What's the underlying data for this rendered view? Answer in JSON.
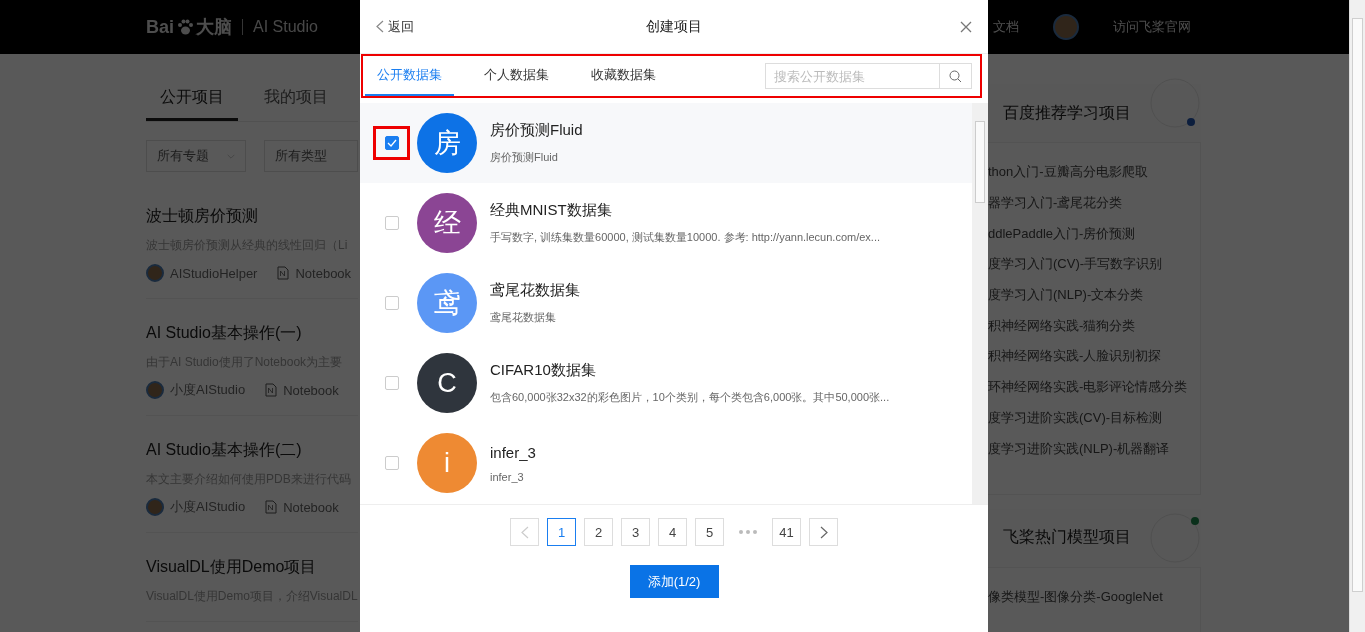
{
  "top_bar": {
    "logo": {
      "mark": "Bai",
      "brand": "大脑",
      "product": "AI Studio"
    },
    "doc_link": "文档",
    "official_link": "访问飞桨官网"
  },
  "project_tabs": [
    {
      "label": "公开项目",
      "selected": true
    },
    {
      "label": "我的项目",
      "selected": false
    }
  ],
  "filters": [
    {
      "value": "所有专题"
    },
    {
      "value": "所有类型"
    }
  ],
  "projects": [
    {
      "title": "波士顿房价预测",
      "description": "波士顿房价预测从经典的线性回归（Li",
      "author": "AIStudioHelper",
      "type": "Notebook"
    },
    {
      "title": "AI Studio基本操作(一)",
      "description": "由于AI Studio使用了Notebook为主要",
      "author": "小度AIStudio",
      "type": "Notebook"
    },
    {
      "title": "AI Studio基本操作(二)",
      "description": "本文主要介绍如何使用PDB来进行代码",
      "author": "小度AIStudio",
      "type": "Notebook"
    },
    {
      "title": "VisualDL使用Demo项目",
      "description": "VisualDL使用Demo项目，介绍VisualDL"
    }
  ],
  "side_cards": [
    {
      "title": "百度推荐学习项目",
      "items": [
        "thon入门-豆瓣高分电影爬取",
        "器学习入门-鸢尾花分类",
        "ddlePaddle入门-房价预测",
        "度学习入门(CV)-手写数字识别",
        "度学习入门(NLP)-文本分类",
        "积神经网络实践-猫狗分类",
        "积神经网络实践-人脸识别初探",
        "环神经网络实践-电影评论情感分类",
        "度学习进阶实践(CV)-目标检测",
        "度学习进阶实践(NLP)-机器翻译"
      ]
    },
    {
      "title": "飞桨热门模型项目",
      "items": [
        "像类模型-图像分类-GoogleNet"
      ]
    }
  ],
  "dialog": {
    "back": "返回",
    "title": "创建项目",
    "tabs_highlighted": true,
    "tabs": [
      {
        "label": "公开数据集",
        "selected": true
      },
      {
        "label": "个人数据集",
        "selected": false
      },
      {
        "label": "收藏数据集",
        "selected": false
      }
    ],
    "search": {
      "placeholder": "搜索公开数据集"
    },
    "datasets": [
      {
        "initial": "房",
        "color": "#0d72e6",
        "title": "房价预测Fluid",
        "description": "房价预测Fluid",
        "checked": true,
        "highlighted": true
      },
      {
        "initial": "经",
        "color": "#8b4594",
        "title": "经典MNIST数据集",
        "description": "手写数字, 训练集数量60000, 测试集数量10000. 参考: http://yann.lecun.com/ex...",
        "checked": false,
        "highlighted": false
      },
      {
        "initial": "鸢",
        "color": "#5b97f5",
        "title": "鸢尾花数据集",
        "description": "鸢尾花数据集",
        "checked": false,
        "highlighted": false
      },
      {
        "initial": "C",
        "color": "#2f353d",
        "title": "CIFAR10数据集",
        "description": "包含60,000张32x32的彩色图片，10个类别，每个类包含6,000张。其中50,000张...",
        "checked": false,
        "highlighted": false
      },
      {
        "initial": "i",
        "color": "#ee8a33",
        "title": "infer_3",
        "description": "infer_3",
        "checked": false,
        "highlighted": false
      }
    ],
    "pages": [
      {
        "label": "1",
        "selected": true
      },
      {
        "label": "2",
        "selected": false
      },
      {
        "label": "3",
        "selected": false
      },
      {
        "label": "4",
        "selected": false
      },
      {
        "label": "5",
        "selected": false
      },
      {
        "label": "41",
        "selected": false
      }
    ],
    "add_button": "添加(1/2)"
  }
}
